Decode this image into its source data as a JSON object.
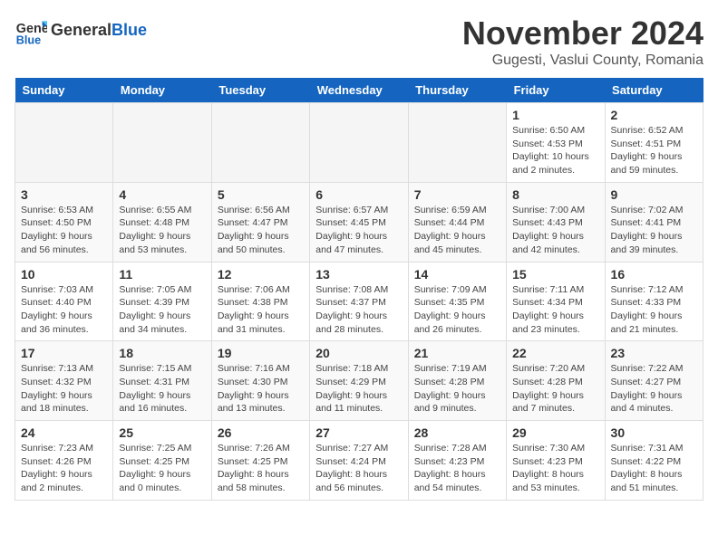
{
  "header": {
    "logo_line1": "General",
    "logo_line2": "Blue",
    "month": "November 2024",
    "location": "Gugesti, Vaslui County, Romania"
  },
  "weekdays": [
    "Sunday",
    "Monday",
    "Tuesday",
    "Wednesday",
    "Thursday",
    "Friday",
    "Saturday"
  ],
  "weeks": [
    [
      {
        "day": "",
        "info": ""
      },
      {
        "day": "",
        "info": ""
      },
      {
        "day": "",
        "info": ""
      },
      {
        "day": "",
        "info": ""
      },
      {
        "day": "",
        "info": ""
      },
      {
        "day": "1",
        "info": "Sunrise: 6:50 AM\nSunset: 4:53 PM\nDaylight: 10 hours\nand 2 minutes."
      },
      {
        "day": "2",
        "info": "Sunrise: 6:52 AM\nSunset: 4:51 PM\nDaylight: 9 hours\nand 59 minutes."
      }
    ],
    [
      {
        "day": "3",
        "info": "Sunrise: 6:53 AM\nSunset: 4:50 PM\nDaylight: 9 hours\nand 56 minutes."
      },
      {
        "day": "4",
        "info": "Sunrise: 6:55 AM\nSunset: 4:48 PM\nDaylight: 9 hours\nand 53 minutes."
      },
      {
        "day": "5",
        "info": "Sunrise: 6:56 AM\nSunset: 4:47 PM\nDaylight: 9 hours\nand 50 minutes."
      },
      {
        "day": "6",
        "info": "Sunrise: 6:57 AM\nSunset: 4:45 PM\nDaylight: 9 hours\nand 47 minutes."
      },
      {
        "day": "7",
        "info": "Sunrise: 6:59 AM\nSunset: 4:44 PM\nDaylight: 9 hours\nand 45 minutes."
      },
      {
        "day": "8",
        "info": "Sunrise: 7:00 AM\nSunset: 4:43 PM\nDaylight: 9 hours\nand 42 minutes."
      },
      {
        "day": "9",
        "info": "Sunrise: 7:02 AM\nSunset: 4:41 PM\nDaylight: 9 hours\nand 39 minutes."
      }
    ],
    [
      {
        "day": "10",
        "info": "Sunrise: 7:03 AM\nSunset: 4:40 PM\nDaylight: 9 hours\nand 36 minutes."
      },
      {
        "day": "11",
        "info": "Sunrise: 7:05 AM\nSunset: 4:39 PM\nDaylight: 9 hours\nand 34 minutes."
      },
      {
        "day": "12",
        "info": "Sunrise: 7:06 AM\nSunset: 4:38 PM\nDaylight: 9 hours\nand 31 minutes."
      },
      {
        "day": "13",
        "info": "Sunrise: 7:08 AM\nSunset: 4:37 PM\nDaylight: 9 hours\nand 28 minutes."
      },
      {
        "day": "14",
        "info": "Sunrise: 7:09 AM\nSunset: 4:35 PM\nDaylight: 9 hours\nand 26 minutes."
      },
      {
        "day": "15",
        "info": "Sunrise: 7:11 AM\nSunset: 4:34 PM\nDaylight: 9 hours\nand 23 minutes."
      },
      {
        "day": "16",
        "info": "Sunrise: 7:12 AM\nSunset: 4:33 PM\nDaylight: 9 hours\nand 21 minutes."
      }
    ],
    [
      {
        "day": "17",
        "info": "Sunrise: 7:13 AM\nSunset: 4:32 PM\nDaylight: 9 hours\nand 18 minutes."
      },
      {
        "day": "18",
        "info": "Sunrise: 7:15 AM\nSunset: 4:31 PM\nDaylight: 9 hours\nand 16 minutes."
      },
      {
        "day": "19",
        "info": "Sunrise: 7:16 AM\nSunset: 4:30 PM\nDaylight: 9 hours\nand 13 minutes."
      },
      {
        "day": "20",
        "info": "Sunrise: 7:18 AM\nSunset: 4:29 PM\nDaylight: 9 hours\nand 11 minutes."
      },
      {
        "day": "21",
        "info": "Sunrise: 7:19 AM\nSunset: 4:28 PM\nDaylight: 9 hours\nand 9 minutes."
      },
      {
        "day": "22",
        "info": "Sunrise: 7:20 AM\nSunset: 4:28 PM\nDaylight: 9 hours\nand 7 minutes."
      },
      {
        "day": "23",
        "info": "Sunrise: 7:22 AM\nSunset: 4:27 PM\nDaylight: 9 hours\nand 4 minutes."
      }
    ],
    [
      {
        "day": "24",
        "info": "Sunrise: 7:23 AM\nSunset: 4:26 PM\nDaylight: 9 hours\nand 2 minutes."
      },
      {
        "day": "25",
        "info": "Sunrise: 7:25 AM\nSunset: 4:25 PM\nDaylight: 9 hours\nand 0 minutes."
      },
      {
        "day": "26",
        "info": "Sunrise: 7:26 AM\nSunset: 4:25 PM\nDaylight: 8 hours\nand 58 minutes."
      },
      {
        "day": "27",
        "info": "Sunrise: 7:27 AM\nSunset: 4:24 PM\nDaylight: 8 hours\nand 56 minutes."
      },
      {
        "day": "28",
        "info": "Sunrise: 7:28 AM\nSunset: 4:23 PM\nDaylight: 8 hours\nand 54 minutes."
      },
      {
        "day": "29",
        "info": "Sunrise: 7:30 AM\nSunset: 4:23 PM\nDaylight: 8 hours\nand 53 minutes."
      },
      {
        "day": "30",
        "info": "Sunrise: 7:31 AM\nSunset: 4:22 PM\nDaylight: 8 hours\nand 51 minutes."
      }
    ]
  ]
}
